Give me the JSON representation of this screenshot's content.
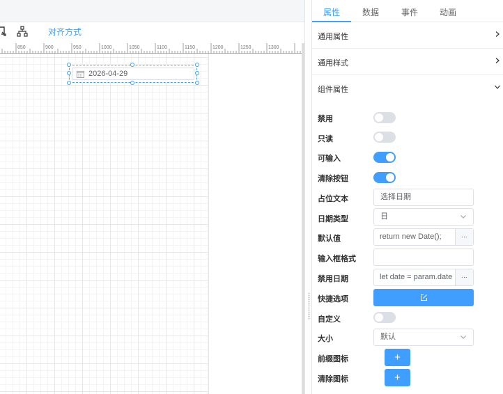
{
  "toolbar": {
    "align_label": "对齐方式"
  },
  "ruler": {
    "ticks": [
      "850",
      "900",
      "950",
      "1000",
      "1050",
      "1100",
      "1150",
      "1200",
      "1250",
      "1300"
    ]
  },
  "canvas": {
    "date_value": "2026-04-29"
  },
  "tabs": [
    {
      "label": "属性",
      "active": true
    },
    {
      "label": "数据",
      "active": false
    },
    {
      "label": "事件",
      "active": false
    },
    {
      "label": "动画",
      "active": false
    }
  ],
  "sections": {
    "common_props": "通用属性",
    "common_style": "通用样式",
    "component_props": "组件属性"
  },
  "props": {
    "disabled": {
      "label": "禁用",
      "on": false
    },
    "readonly": {
      "label": "只读",
      "on": false
    },
    "editable": {
      "label": "可输入",
      "on": true
    },
    "clearable": {
      "label": "清除按钮",
      "on": true
    },
    "placeholder": {
      "label": "占位文本",
      "value": "选择日期"
    },
    "date_type": {
      "label": "日期类型",
      "value": "日"
    },
    "default_value": {
      "label": "默认值",
      "value": "return new Date();",
      "more": "..."
    },
    "input_format": {
      "label": "输入框格式",
      "value": ""
    },
    "disabled_date": {
      "label": "禁用日期",
      "value": "let date = param.date",
      "more": "..."
    },
    "shortcuts": {
      "label": "快捷选项"
    },
    "custom": {
      "label": "自定义",
      "on": false
    },
    "size": {
      "label": "大小",
      "value": "默认"
    },
    "prefix_icon": {
      "label": "前缀图标",
      "button": "+"
    },
    "clear_icon": {
      "label": "清除图标",
      "button": "+"
    }
  },
  "colors": {
    "accent": "#409eff",
    "border": "#dcdfe6",
    "switch_off": "#dcdfe6"
  }
}
